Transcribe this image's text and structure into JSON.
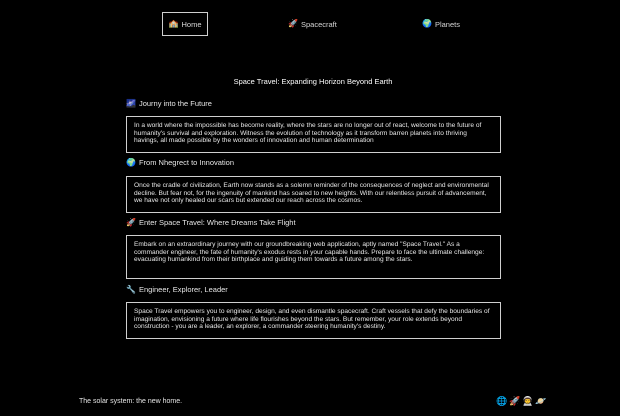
{
  "nav": {
    "home": {
      "label": "Home",
      "icon": "🏫"
    },
    "spacecraft": {
      "label": "Spacecraft",
      "icon": "🚀"
    },
    "planets": {
      "label": "Planets",
      "icon": "🌍"
    }
  },
  "page_title": "Space Travel: Expanding Horizon Beyond Earth",
  "sections": [
    {
      "heading": "Journy into the Future",
      "icon": "🌌",
      "body": "In a world where the impossible has become reality, where the stars are no longer out of react, welcome to the future of humanity's survival and exploration. Witness the evolution of technology as it transform barren planets into thriving havings, all made possible by the wonders of innovation and human determination"
    },
    {
      "heading": "From Nhegrect to Innovation",
      "icon": "🌍",
      "body": "Once the cradle of civilization, Earth now stands as a solemn reminder of the consequences of neglect and environmental decline. But fear not, for the ingenuity of mankind has soared to new heights. With our relentless pursuit of advancement, we have not only healed our scars but extended our reach across the cosmos."
    },
    {
      "heading": "Enter Space Travel: Where Dreams Take Flight",
      "icon": "🚀",
      "body": "Embark on an extraordinary journey with our groundbreaking web application, aptly named \"Space Travel.\" As a commander engineer, the fate of humanity's exodus rests in your capable hands. Prepare to face the ultimate challenge: evacuating humankind from their birthplace and guiding them towards a future among the stars."
    },
    {
      "heading": "Engineer, Explorer, Leader",
      "icon": "🔧",
      "body": "Space Travel empowers you to engineer, design, and even dismantle spacecraft. Craft vessels that defy the boundaries of imagination, envisioning a future where life flourishes beyond the stars. But remember, your role extends beyond construction - you are a leader, an explorer, a commander steering humanity's destiny."
    }
  ],
  "footer": {
    "text": "The solar system: the new home.",
    "icons": [
      {
        "name": "globe-icon",
        "glyph": "🌐"
      },
      {
        "name": "rocket-icon",
        "glyph": "🚀"
      },
      {
        "name": "astronaut-icon",
        "glyph": "👨‍🚀"
      },
      {
        "name": "ringed-planet-icon",
        "glyph": "🪐"
      }
    ]
  }
}
